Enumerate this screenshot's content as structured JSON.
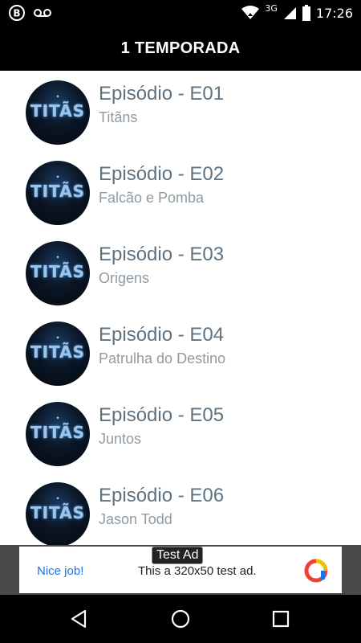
{
  "status_bar": {
    "time": "17:26",
    "network": "3G",
    "icons": [
      "b-messenger-icon",
      "voicemail-icon",
      "wifi-icon",
      "signal-icon",
      "battery-icon"
    ]
  },
  "header": {
    "title": "1 TEMPORADA"
  },
  "thumbnail_text": "TITÃS",
  "episodes": [
    {
      "title": "Episódio - E01",
      "subtitle": "Titãns"
    },
    {
      "title": "Episódio - E02",
      "subtitle": "Falcão e Pomba"
    },
    {
      "title": "Episódio - E03",
      "subtitle": "Origens"
    },
    {
      "title": "Episódio - E04",
      "subtitle": "Patrulha do Destino"
    },
    {
      "title": "Episódio - E05",
      "subtitle": "Juntos"
    },
    {
      "title": "Episódio - E06",
      "subtitle": "Jason Todd"
    }
  ],
  "ad": {
    "badge": "Test Ad",
    "cta": "Nice job!",
    "text": "This a 320x50 test ad."
  },
  "nav": {
    "icons": [
      "back-icon",
      "home-icon",
      "recents-icon"
    ]
  },
  "colors": {
    "header_bg": "#000000",
    "title_text": "#5f7280",
    "subtitle_text": "#8f9aa2",
    "ad_link": "#1a73e8"
  }
}
